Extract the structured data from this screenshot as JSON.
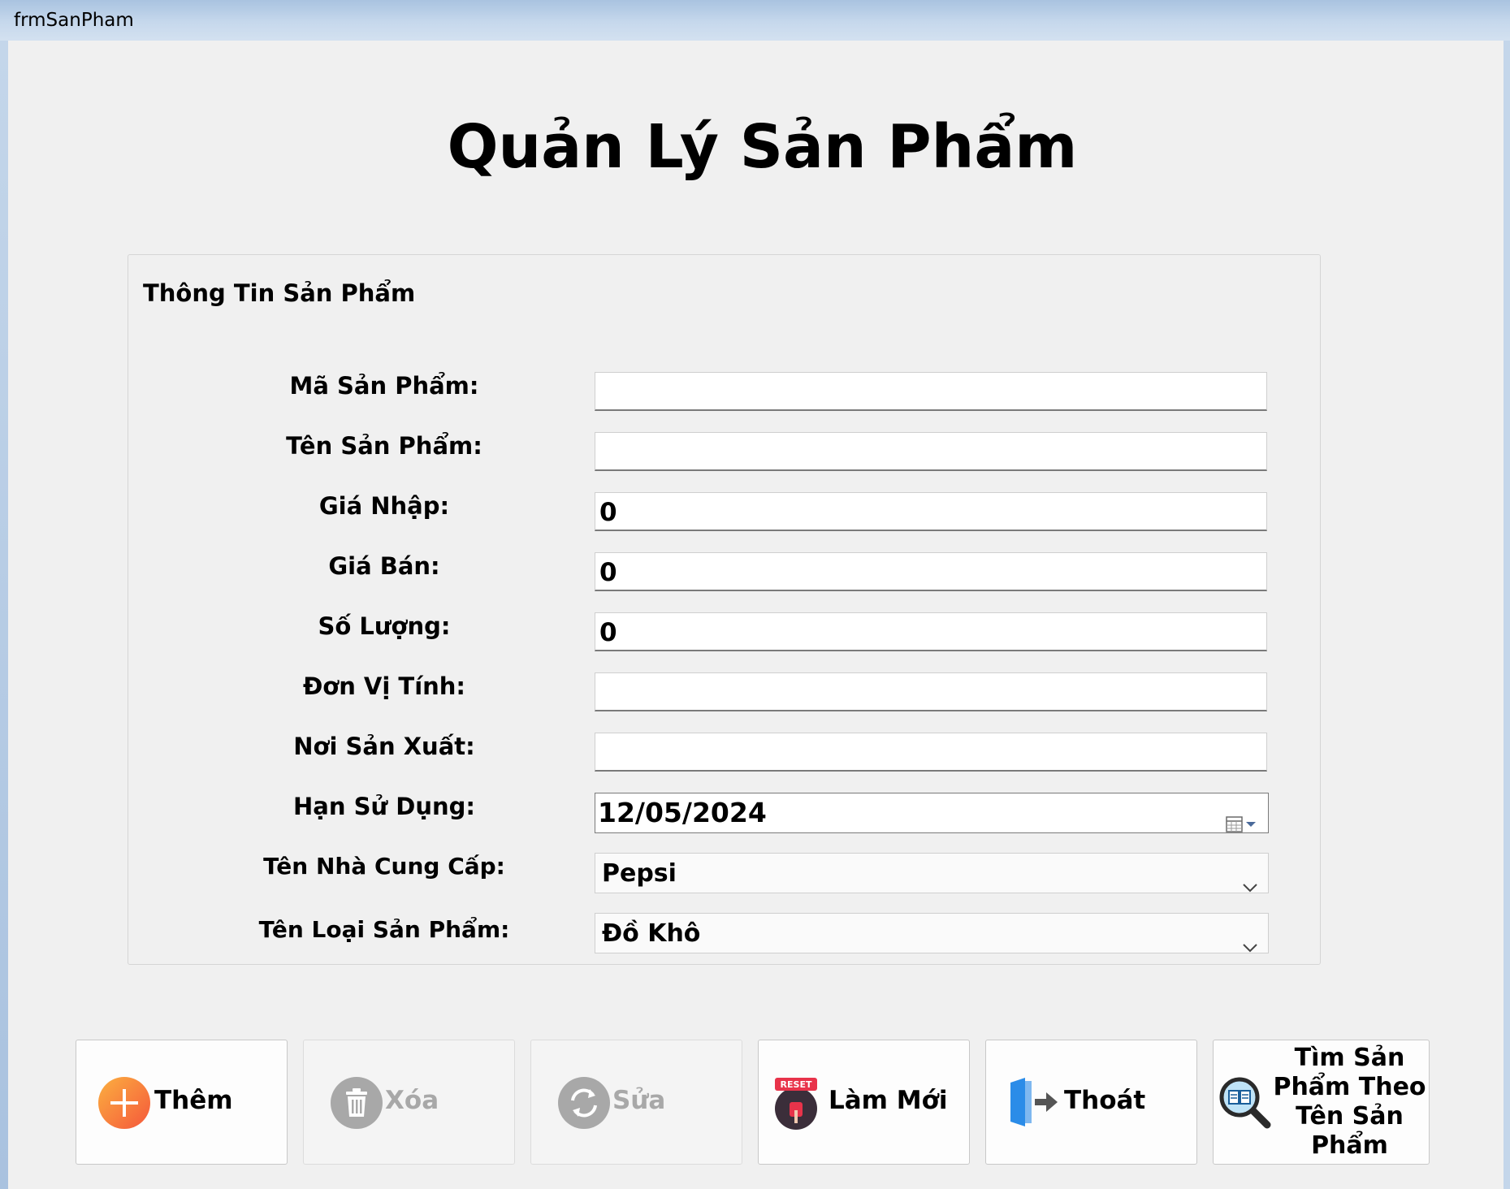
{
  "window": {
    "title": "frmSanPham"
  },
  "heading": "Quản Lý Sản Phẩm",
  "group_title": "Thông Tin Sản Phẩm",
  "fields": {
    "ma_san_pham": {
      "label": "Mã Sản Phẩm:",
      "value": ""
    },
    "ten_san_pham": {
      "label": "Tên Sản Phẩm:",
      "value": ""
    },
    "gia_nhap": {
      "label": "Giá Nhập:",
      "value": "0"
    },
    "gia_ban": {
      "label": "Giá Bán:",
      "value": "0"
    },
    "so_luong": {
      "label": "Số Lượng:",
      "value": "0"
    },
    "don_vi_tinh": {
      "label": "Đơn Vị Tính:",
      "value": ""
    },
    "noi_san_xuat": {
      "label": "Nơi Sản Xuất:",
      "value": ""
    },
    "han_su_dung": {
      "label": "Hạn Sử Dụng:",
      "value": "12/05/2024"
    },
    "nha_cung_cap": {
      "label": "Tên Nhà Cung Cấp:",
      "value": "Pepsi"
    },
    "loai_san_pham": {
      "label": "Tên Loại Sản Phẩm:",
      "value": "Đồ Khô"
    }
  },
  "buttons": {
    "them": {
      "label": "Thêm",
      "icon": "add-icon",
      "enabled": true
    },
    "xoa": {
      "label": "Xóa",
      "icon": "trash-icon",
      "enabled": false
    },
    "sua": {
      "label": "Sửa",
      "icon": "refresh-icon",
      "enabled": false
    },
    "lam_moi": {
      "label": "Làm Mới",
      "icon": "reset-icon",
      "badge": "RESET",
      "enabled": true
    },
    "thoat": {
      "label": "Thoát",
      "icon": "exit-door-icon",
      "enabled": true
    },
    "tim": {
      "label": "Tìm Sản Phẩm Theo Tên Sản Phẩm",
      "icon": "search-book-icon",
      "enabled": true
    }
  },
  "colors": {
    "add_orange": "#f98a2a",
    "disabled_gray": "#a8a8a8",
    "exit_blue": "#2b8ce8",
    "reset_red": "#e8334a",
    "window_bg": "#f0f0f0"
  }
}
